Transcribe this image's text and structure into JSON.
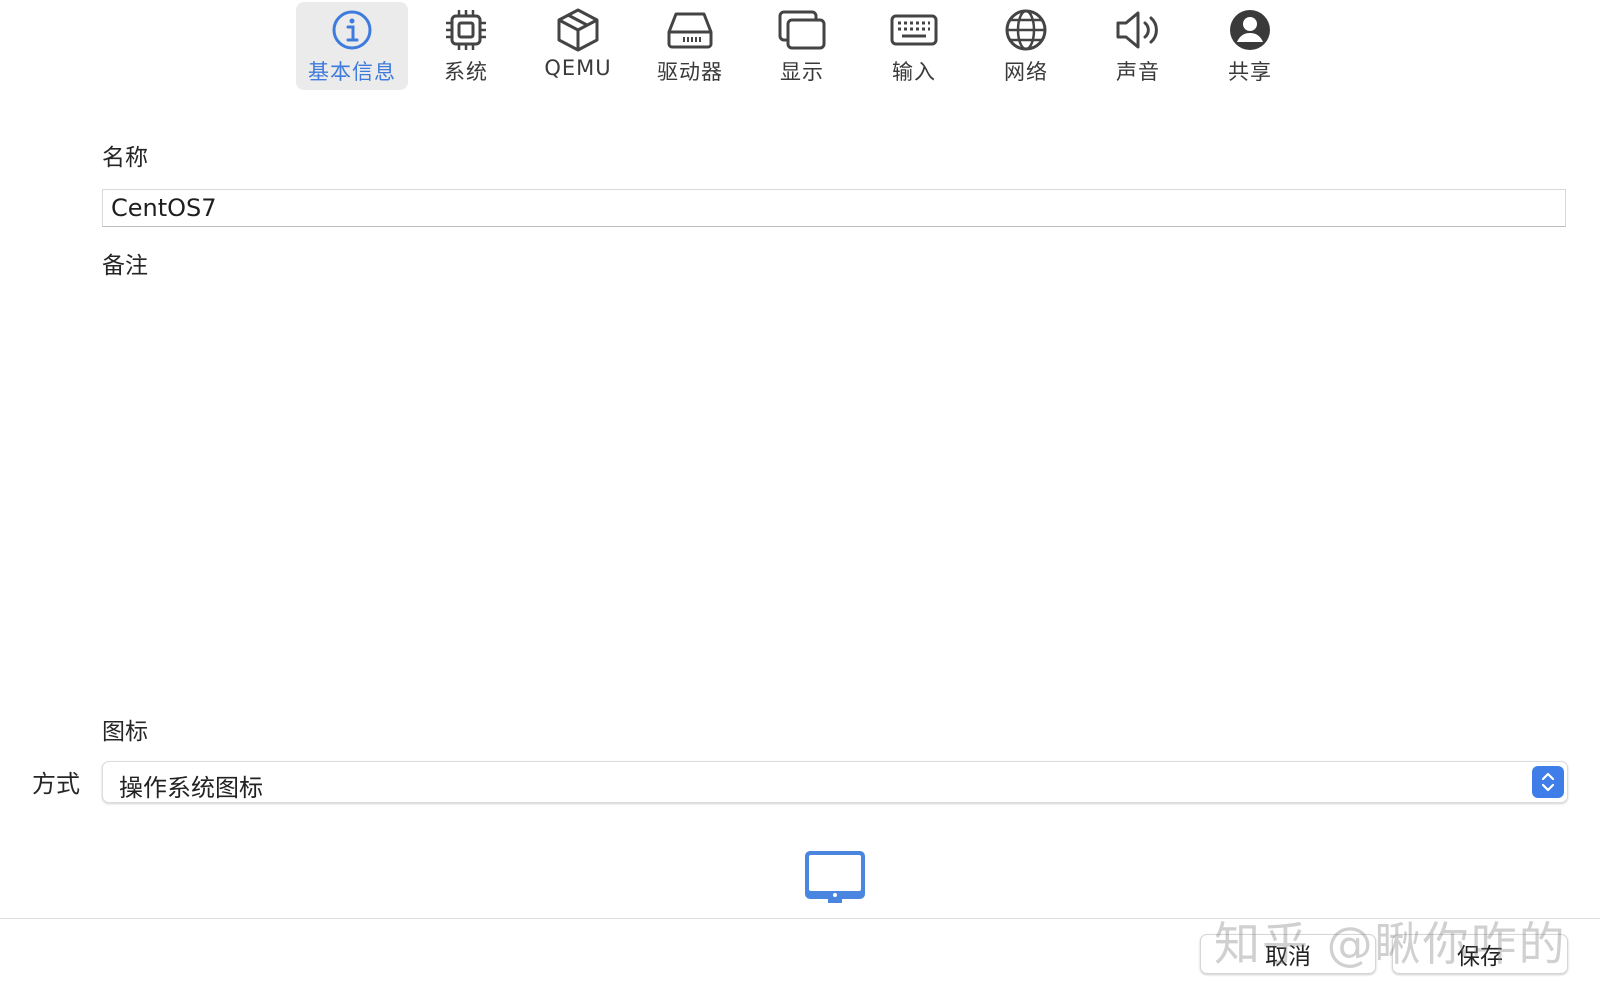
{
  "toolbar": {
    "tabs": [
      {
        "label": "基本信息",
        "icon": "info-icon",
        "active": true
      },
      {
        "label": "系统",
        "icon": "cpu-icon"
      },
      {
        "label": "QEMU",
        "icon": "box-icon"
      },
      {
        "label": "驱动器",
        "icon": "drive-icon"
      },
      {
        "label": "显示",
        "icon": "display-icon"
      },
      {
        "label": "输入",
        "icon": "keyboard-icon"
      },
      {
        "label": "网络",
        "icon": "globe-icon"
      },
      {
        "label": "声音",
        "icon": "speaker-icon"
      },
      {
        "label": "共享",
        "icon": "person-icon"
      }
    ],
    "accent_color": "#3f7bdc"
  },
  "form": {
    "name_label": "名称",
    "name_value": "CentOS7",
    "notes_label": "备注",
    "notes_value": "",
    "icon_label": "图标",
    "method_label": "方式",
    "method_value": "操作系统图标",
    "preview_icon": "computer-display-icon"
  },
  "footer": {
    "cancel_label": "取消",
    "save_label": "保存"
  },
  "watermark": "知乎 @瞅你咋的"
}
